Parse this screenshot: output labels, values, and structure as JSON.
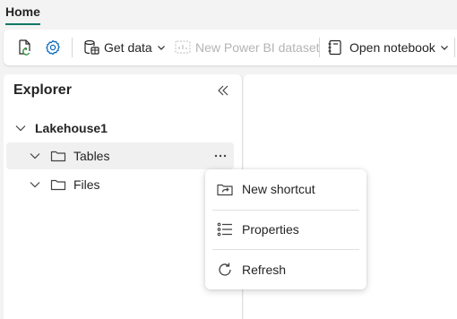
{
  "tabs": {
    "home": "Home"
  },
  "ribbon": {
    "get_data": "Get data",
    "new_dataset": "New Power BI dataset",
    "open_notebook": "Open notebook"
  },
  "explorer": {
    "title": "Explorer",
    "root": "Lakehouse1",
    "items": [
      {
        "label": "Tables"
      },
      {
        "label": "Files"
      }
    ]
  },
  "context_menu": {
    "items": [
      {
        "label": "New shortcut",
        "icon": "shortcut-icon"
      },
      {
        "label": "Properties",
        "icon": "list-icon"
      },
      {
        "label": "Refresh",
        "icon": "refresh-icon"
      }
    ]
  },
  "colors": {
    "accent": "#117865",
    "brand_icon": "#0f6cbd"
  }
}
